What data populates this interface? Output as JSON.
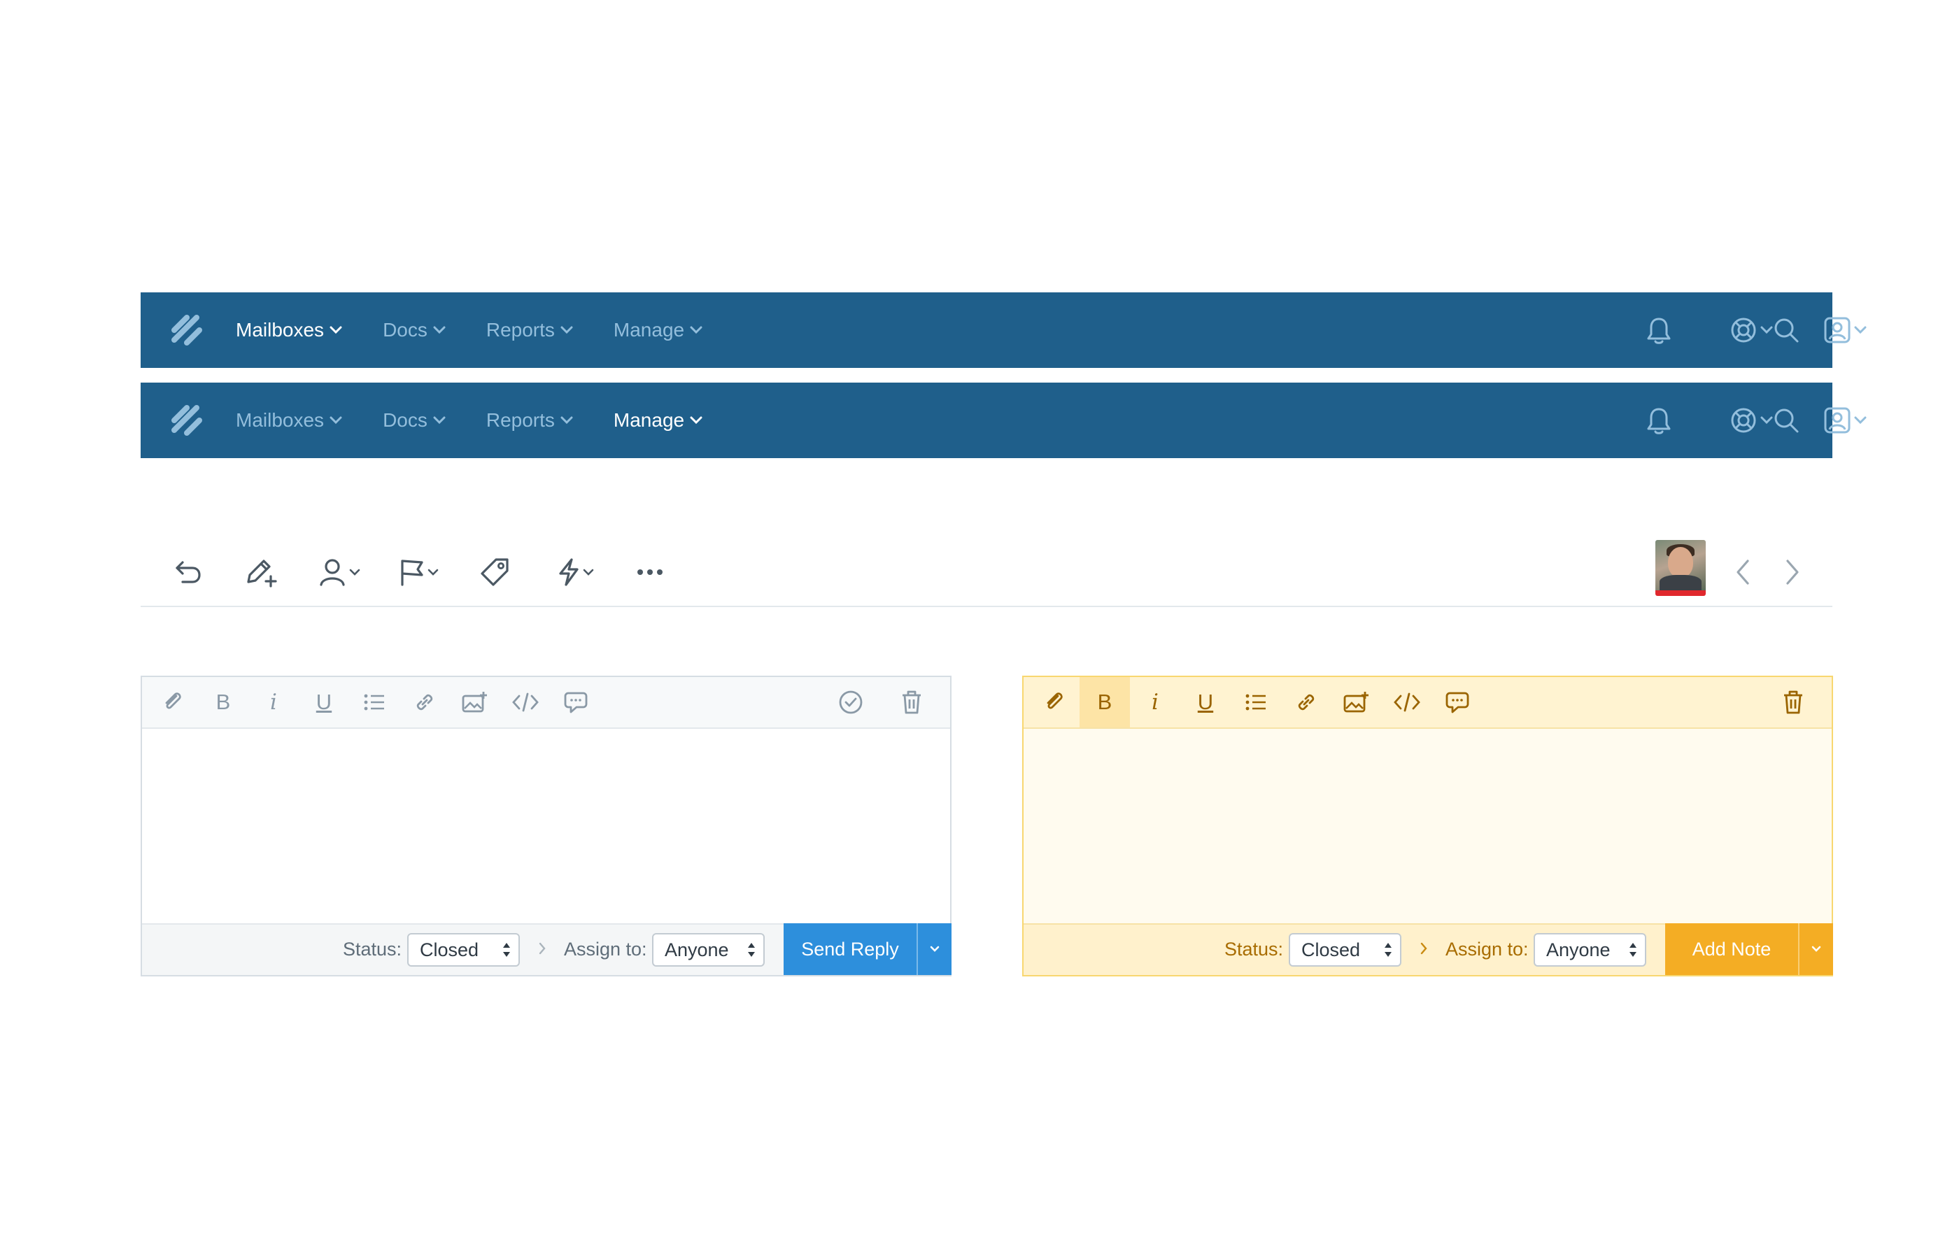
{
  "colors": {
    "navbar_bg": "#1f5f8b",
    "nav_inactive": "#93bedc",
    "nav_active": "#ffffff",
    "reply_accent": "#2d8fdc",
    "note_accent": "#f4ad24",
    "note_bg": "#fffbef",
    "note_text": "#a86c00",
    "avatar_status": "#e0282d"
  },
  "navbars": [
    {
      "logo_icon": "helpscout-logo-icon",
      "active_item": "Mailboxes",
      "items": [
        {
          "label": "Mailboxes"
        },
        {
          "label": "Docs"
        },
        {
          "label": "Reports"
        },
        {
          "label": "Manage"
        }
      ],
      "right_icons": [
        "bell-icon",
        "lifebuoy-icon",
        "profile-icon",
        "search-icon"
      ]
    },
    {
      "logo_icon": "helpscout-logo-icon",
      "active_item": "Manage",
      "items": [
        {
          "label": "Mailboxes"
        },
        {
          "label": "Docs"
        },
        {
          "label": "Reports"
        },
        {
          "label": "Manage"
        }
      ],
      "right_icons": [
        "bell-icon",
        "lifebuoy-icon",
        "profile-icon",
        "search-icon"
      ]
    }
  ],
  "conversation_toolbar": {
    "actions": [
      "reply-icon",
      "note-icon",
      "assign-icon",
      "status-flag-icon",
      "tag-icon",
      "workflow-icon",
      "more-icon"
    ],
    "right": [
      "avatar",
      "previous-icon",
      "next-icon"
    ]
  },
  "reply_editor": {
    "toolbar_icons": [
      "attachment-icon",
      "bold-icon",
      "italic-icon",
      "underline-icon",
      "list-icon",
      "link-icon",
      "image-icon",
      "code-icon",
      "saved-reply-icon",
      "check-circle-icon",
      "trash-icon"
    ],
    "bold": "B",
    "italic": "i",
    "underline": "U",
    "status_label": "Status:",
    "status_value": "Closed",
    "assign_label": "Assign to:",
    "assign_value": "Anyone",
    "submit_label": "Send Reply"
  },
  "note_editor": {
    "toolbar_icons": [
      "attachment-icon",
      "bold-icon",
      "italic-icon",
      "underline-icon",
      "list-icon",
      "link-icon",
      "image-icon",
      "code-icon",
      "saved-reply-icon",
      "trash-icon"
    ],
    "bold": "B",
    "italic": "i",
    "underline": "U",
    "status_label": "Status:",
    "status_value": "Closed",
    "assign_label": "Assign to:",
    "assign_value": "Anyone",
    "submit_label": "Add Note"
  }
}
